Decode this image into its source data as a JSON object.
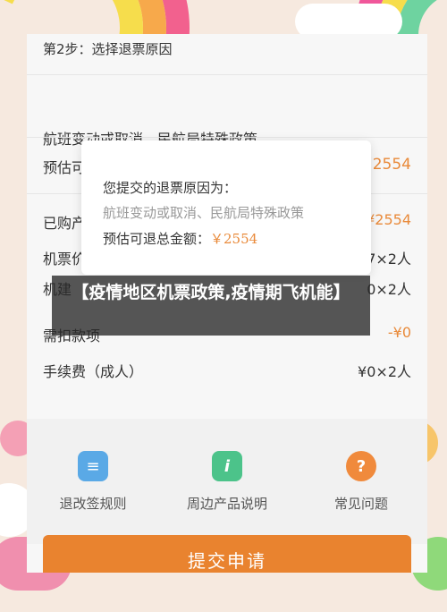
{
  "step": {
    "title": "第2步：选择退票原因"
  },
  "reason": {
    "selected": "航班变动或取消、民航局特殊政策"
  },
  "rows": [
    {
      "label": "预估可",
      "value": "2554"
    },
    {
      "label": "已购产",
      "value": "¥2554"
    },
    {
      "label": "机票价",
      "value": "7×2人"
    },
    {
      "label": "机建",
      "value": "0×2人"
    },
    {
      "label": "需扣款项",
      "value": "-¥0"
    },
    {
      "label": "手续费（成人）",
      "value": "¥0×2人"
    }
  ],
  "tabs": [
    {
      "label": "退改签规则",
      "icon": "document-icon"
    },
    {
      "label": "周边产品说明",
      "icon": "ticket-icon"
    },
    {
      "label": "常见问题",
      "icon": "question-icon"
    }
  ],
  "submit": {
    "label": "提交申请"
  },
  "modal": {
    "line1": "您提交的退票原因为：",
    "line2": "航班变动或取消、民航局特殊政策",
    "line3_prefix": "预估可退总金额：",
    "line3_amount": "￥2554"
  },
  "banner": {
    "text": "【疫情地区机票政策,疫情期飞机能】"
  },
  "colors": {
    "accent": "#e9832f",
    "amount": "#e98a3a"
  }
}
